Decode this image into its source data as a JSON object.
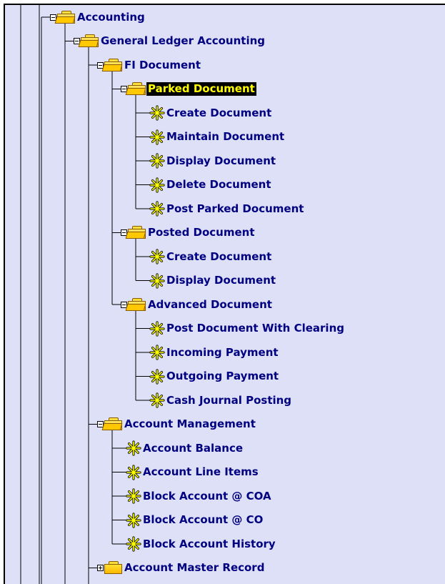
{
  "tree": [
    {
      "label": "Accounting",
      "type": "folder",
      "level": 0,
      "expanded": true
    },
    {
      "label": "General Ledger Accounting",
      "type": "folder",
      "level": 1,
      "expanded": true
    },
    {
      "label": "FI Document",
      "type": "folder",
      "level": 2,
      "expanded": true
    },
    {
      "label": "Parked Document",
      "type": "folder",
      "level": 3,
      "expanded": true,
      "selected": true
    },
    {
      "label": "Create Document",
      "type": "transaction",
      "level": 4
    },
    {
      "label": "Maintain Document",
      "type": "transaction",
      "level": 4
    },
    {
      "label": "Display Document",
      "type": "transaction",
      "level": 4
    },
    {
      "label": "Delete Document",
      "type": "transaction",
      "level": 4
    },
    {
      "label": "Post Parked Document",
      "type": "transaction",
      "level": 4
    },
    {
      "label": "Posted Document",
      "type": "folder",
      "level": 3,
      "expanded": true
    },
    {
      "label": "Create Document",
      "type": "transaction",
      "level": 4
    },
    {
      "label": "Display Document",
      "type": "transaction",
      "level": 4
    },
    {
      "label": "Advanced Document",
      "type": "folder",
      "level": 3,
      "expanded": true
    },
    {
      "label": "Post Document With Clearing",
      "type": "transaction",
      "level": 4
    },
    {
      "label": "Incoming Payment",
      "type": "transaction",
      "level": 4
    },
    {
      "label": "Outgoing Payment",
      "type": "transaction",
      "level": 4
    },
    {
      "label": "Cash Journal Posting",
      "type": "transaction",
      "level": 4
    },
    {
      "label": "Account Management",
      "type": "folder",
      "level": 2,
      "expanded": true
    },
    {
      "label": "Account Balance",
      "type": "transaction",
      "level": 3
    },
    {
      "label": "Account Line Items",
      "type": "transaction",
      "level": 3
    },
    {
      "label": "Block Account @ COA",
      "type": "transaction",
      "level": 3
    },
    {
      "label": "Block Account @ CO",
      "type": "transaction",
      "level": 3
    },
    {
      "label": "Block Account History",
      "type": "transaction",
      "level": 3
    },
    {
      "label": "Account Master Record",
      "type": "folder",
      "level": 2,
      "expanded": false
    }
  ],
  "colors": {
    "background": "#dde0f6",
    "label": "#000080",
    "selected_bg": "#000000",
    "selected_text": "#ffff00",
    "folder": "#ffc800",
    "star": "#ffff00"
  }
}
